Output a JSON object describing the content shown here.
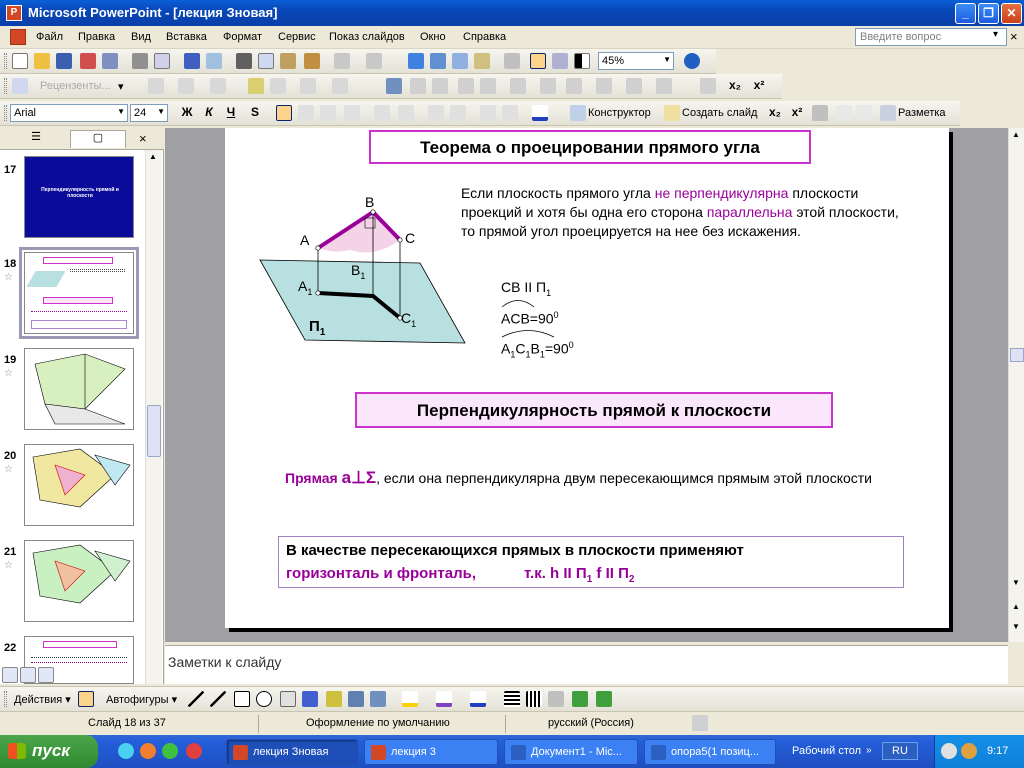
{
  "window": {
    "title": "Microsoft PowerPoint - [лекция Зновая]",
    "app_icon_letter": "P",
    "minimize": "_",
    "restore": "❐",
    "close": "✕"
  },
  "menu": {
    "items": [
      "Файл",
      "Правка",
      "Вид",
      "Вставка",
      "Формат",
      "Сервис",
      "Показ слайдов",
      "Окно",
      "Справка"
    ],
    "help_placeholder": "Введите вопрос",
    "close_doc": "×"
  },
  "toolbar_standard": {
    "zoom": "45%"
  },
  "toolbar_review": {
    "reviewers": "Рецензенты...",
    "more": "▾"
  },
  "toolbar_formatting": {
    "font": "Arial",
    "font_size": "24",
    "bold": "Ж",
    "italic": "К",
    "underline": "Ч",
    "shadow": "S",
    "designer": "Конструктор",
    "new_slide": "Создать слайд",
    "layout": "Разметка",
    "subscript": "x₂",
    "superscript": "x²"
  },
  "slides_pane": {
    "tab_outline": "☰",
    "tab_slides": "▢",
    "close": "×",
    "thumbnails": [
      {
        "num": "17",
        "star": ""
      },
      {
        "num": "18",
        "star": "☆"
      },
      {
        "num": "19",
        "star": "☆"
      },
      {
        "num": "20",
        "star": "☆"
      },
      {
        "num": "21",
        "star": "☆"
      },
      {
        "num": "22",
        "star": ""
      }
    ],
    "thumb17_text": "Перпендикулярность прямой и плоскости"
  },
  "slide": {
    "title1": "Теорема о проецировании прямого угла",
    "theorem": {
      "part1": "Если плоскость  прямого угла ",
      "part2": "не перпендикулярна",
      "part3": " плоскости проекций и хотя бы одна его сторона ",
      "part4": "параллельна",
      "part5": " этой плоскости, то прямой угол проецируется на  нее без искажения."
    },
    "diagram_labels": {
      "A": "A",
      "B": "B",
      "C": "C",
      "A1": "A",
      "B1": "B",
      "C1": "C",
      "sub1": "1",
      "plane": "П",
      "plane_sub": "1"
    },
    "formulas": {
      "f1_main": "CB ",
      "f1_par": "II",
      "f1_rest": " П",
      "f1_sub": "1",
      "f2": "ACB=90",
      "f2_sup": "0",
      "f3_A": "A",
      "f3_C": "C",
      "f3_B": "B",
      "f3_sub": "1",
      "f3_eq": "=90",
      "f3_sup": "0"
    },
    "title2": "Перпендикулярность  прямой к плоскости",
    "definition": {
      "bold_part": "Прямая ",
      "symbol": "a⊥Σ",
      "comma": ",",
      "rest": "  если она перпендикулярна двум пересекающимся прямым этой плоскости"
    },
    "box3": {
      "line1": "В качестве пересекающихся прямых в плоскости применяют",
      "line2_magenta": "горизонталь и фронталь,",
      "line2_tk": "т.к.   h ",
      "par": "II",
      "p": " П",
      "sub1": "1",
      "f": "  f ",
      "p2": " П",
      "sub2": "2"
    }
  },
  "notes": {
    "placeholder": "Заметки к слайду"
  },
  "drawing_toolbar": {
    "actions": "Действия",
    "autoshapes": "Автофигуры"
  },
  "status": {
    "slide_of": "Слайд 18 из 37",
    "design": "Оформление по умолчанию",
    "language": "русский (Россия)"
  },
  "taskbar": {
    "start": "пуск",
    "tasks": [
      {
        "label": "лекция Зновая",
        "active": true
      },
      {
        "label": "лекция 3",
        "active": false
      },
      {
        "label": "Документ1 - Mic...",
        "active": false
      },
      {
        "label": "опора5(1 позиц...",
        "active": false
      }
    ],
    "desktop": "Рабочий стол",
    "lang": "RU",
    "time": "9:17"
  },
  "colors": {
    "accent_magenta": "#990099",
    "box_border": "#cc33cc",
    "plane_fill": "#b9e0e0",
    "title_bar": "#0a5fd6"
  }
}
